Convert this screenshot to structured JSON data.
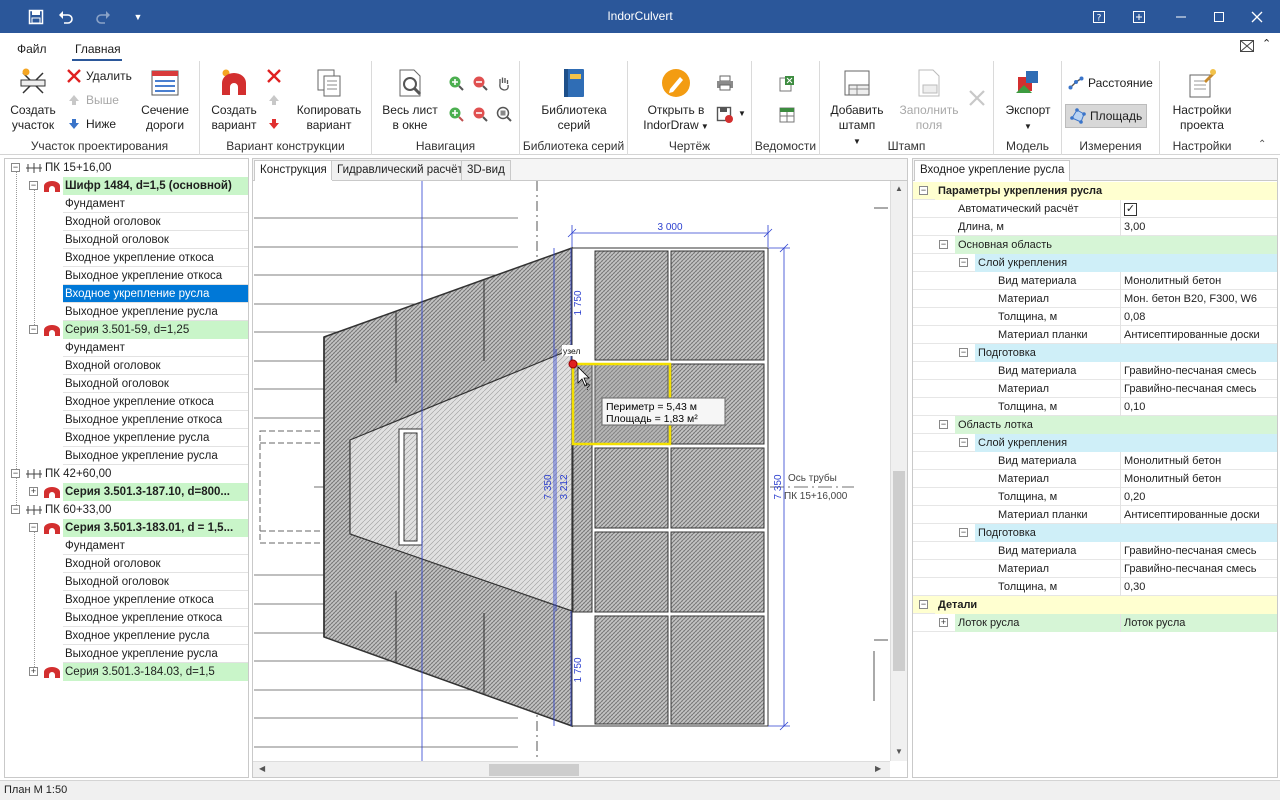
{
  "window": {
    "title": "IndorCulvert"
  },
  "menu": {
    "file": "Файл",
    "home": "Главная"
  },
  "ribbon": {
    "groups": {
      "site": "Участок проектирования",
      "variant": "Вариант конструкции",
      "nav": "Навигация",
      "library": "Библиотека серий",
      "drawing": "Чертёж",
      "sheets": "Ведомости",
      "stamp": "Штамп",
      "model": "Модель",
      "measure": "Измерения",
      "settings": "Настройки"
    },
    "create_site": "Создать участок",
    "delete": "Удалить",
    "up": "Выше",
    "down": "Ниже",
    "road_section": "Сечение дороги",
    "create_variant": "Создать вариант",
    "copy_variant": "Копировать вариант",
    "whole_sheet": "Весь лист в окне",
    "series_library": "Библиотека серий",
    "open_indordraw": "Открыть в IndorDraw",
    "add_stamp": "Добавить штамп",
    "fill_fields": "Заполнить поля",
    "export": "Экспорт",
    "distance": "Расстояние",
    "area": "Площадь",
    "project_settings": "Настройки проекта"
  },
  "tree": {
    "pk1": "ПК 15+16,00",
    "v1": "Шифр 1484, d=1,5 (основной)",
    "v1_children": [
      "Фундамент",
      "Входной оголовок",
      "Выходной оголовок",
      "Входное укрепление откоса",
      "Выходное укрепление откоса",
      "Входное укрепление русла",
      "Выходное укрепление русла"
    ],
    "v2": "Серия 3.501-59, d=1,25",
    "v2_children": [
      "Фундамент",
      "Входной оголовок",
      "Выходной оголовок",
      "Входное укрепление откоса",
      "Выходное укрепление откоса",
      "Входное укрепление русла",
      "Выходное укрепление русла"
    ],
    "pk2": "ПК 42+60,00",
    "v3": "Серия 3.501.3-187.10, d=800...",
    "pk3": "ПК 60+33,00",
    "v4": "Серия 3.501.3-183.01, d = 1,5...",
    "v4_children": [
      "Фундамент",
      "Входной оголовок",
      "Выходной оголовок",
      "Входное укрепление откоса",
      "Выходное укрепление откоса",
      "Входное укрепление русла",
      "Выходное укрепление русла"
    ],
    "v5": "Серия 3.501.3-184.03, d=1,5"
  },
  "center": {
    "tabs": [
      "Конструкция",
      "Гидравлический расчёт",
      "3D-вид"
    ],
    "drawing": {
      "dim_top": "3 000",
      "dim_1750_top": "1 750",
      "dim_1750_bottom": "1 750",
      "dim_7350_left": "7 350",
      "dim_3212": "3 212",
      "dim_7350_right": "7 350",
      "axis_label": "Ось трубы",
      "axis_pk": "ПК 15+16,000",
      "node_label": "узел",
      "tooltip_perimeter": "Периметр = 5,43 м",
      "tooltip_area": "Площадь = 1,83 м²"
    }
  },
  "props": {
    "tab": "Входное укрепление русла",
    "rows": [
      {
        "level": 0,
        "type": "cat",
        "key": "Параметры укрепления русла",
        "bg": "#ffffd0"
      },
      {
        "level": 1,
        "type": "check",
        "key": "Автоматический расчёт",
        "value": "✓"
      },
      {
        "level": 1,
        "key": "Длина, м",
        "value": "3,00"
      },
      {
        "level": 1,
        "type": "group",
        "key": "Основная область",
        "bg": "#d6f5d6"
      },
      {
        "level": 2,
        "type": "group",
        "key": "Слой укрепления",
        "bg": "#cfeff8"
      },
      {
        "level": 3,
        "key": "Вид материала",
        "value": "Монолитный бетон"
      },
      {
        "level": 3,
        "key": "Материал",
        "value": "Мон. бетон B20, F300, W6"
      },
      {
        "level": 3,
        "key": "Толщина, м",
        "value": "0,08"
      },
      {
        "level": 3,
        "key": "Материал планки",
        "value": "Антисептированные доски"
      },
      {
        "level": 2,
        "type": "group",
        "key": "Подготовка",
        "bg": "#cfeff8"
      },
      {
        "level": 3,
        "key": "Вид материала",
        "value": "Гравийно-песчаная смесь"
      },
      {
        "level": 3,
        "key": "Материал",
        "value": "Гравийно-песчаная смесь"
      },
      {
        "level": 3,
        "key": "Толщина, м",
        "value": "0,10"
      },
      {
        "level": 1,
        "type": "group",
        "key": "Область лотка",
        "bg": "#d6f5d6"
      },
      {
        "level": 2,
        "type": "group",
        "key": "Слой укрепления",
        "bg": "#cfeff8"
      },
      {
        "level": 3,
        "key": "Вид материала",
        "value": "Монолитный бетон"
      },
      {
        "level": 3,
        "key": "Материал",
        "value": "Монолитный бетон"
      },
      {
        "level": 3,
        "key": "Толщина, м",
        "value": "0,20"
      },
      {
        "level": 3,
        "key": "Материал планки",
        "value": "Антисептированные доски"
      },
      {
        "level": 2,
        "type": "group",
        "key": "Подготовка",
        "bg": "#cfeff8"
      },
      {
        "level": 3,
        "key": "Вид материала",
        "value": "Гравийно-песчаная смесь"
      },
      {
        "level": 3,
        "key": "Материал",
        "value": "Гравийно-песчаная смесь"
      },
      {
        "level": 3,
        "key": "Толщина, м",
        "value": "0,30"
      },
      {
        "level": 0,
        "type": "cat",
        "key": "Детали",
        "bg": "#ffffd0"
      },
      {
        "level": 1,
        "type": "collapsed",
        "key": "Лоток русла",
        "value": "Лоток русла",
        "bg": "#d6f5d6"
      }
    ]
  },
  "status": {
    "text": "План М 1:50"
  }
}
